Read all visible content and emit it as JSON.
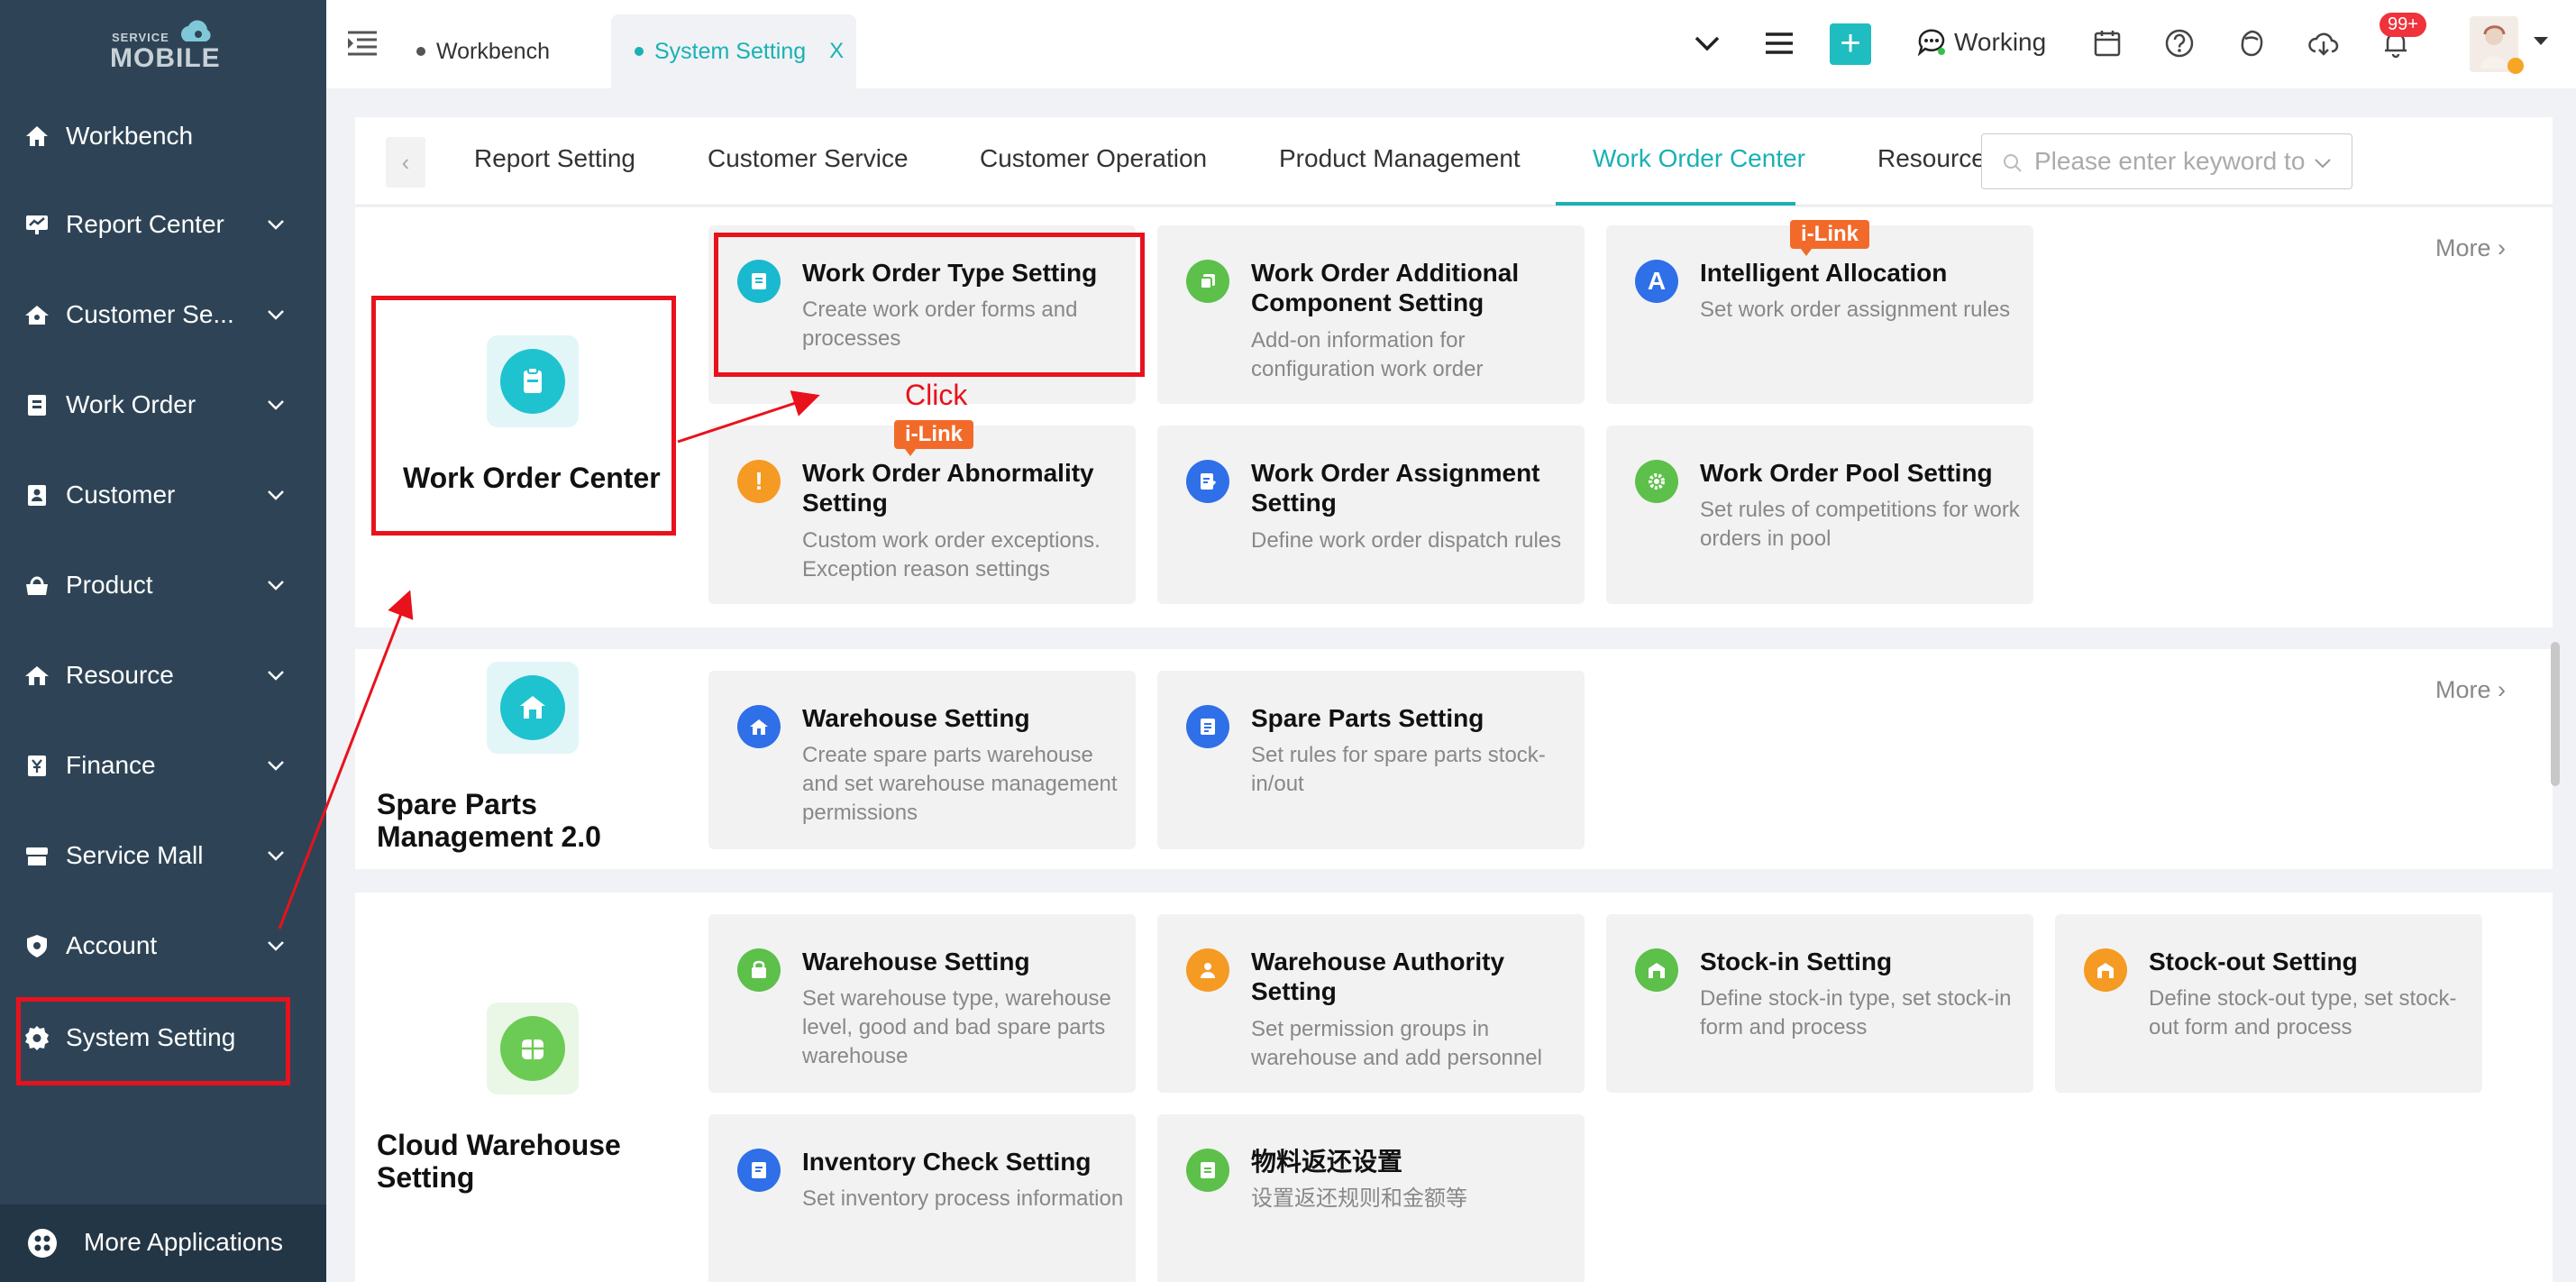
{
  "sidebar": {
    "logo_small": "SERVICE",
    "logo_big": "MOBILE",
    "items": [
      {
        "label": "Workbench",
        "icon": "home-icon",
        "has_chevron": false
      },
      {
        "label": "Report Center",
        "icon": "chart-icon",
        "has_chevron": true
      },
      {
        "label": "Customer Se...",
        "icon": "customer-service-icon",
        "has_chevron": true
      },
      {
        "label": "Work Order",
        "icon": "clipboard-icon",
        "has_chevron": true
      },
      {
        "label": "Customer",
        "icon": "person-card-icon",
        "has_chevron": true
      },
      {
        "label": "Product",
        "icon": "product-icon",
        "has_chevron": true
      },
      {
        "label": "Resource",
        "icon": "resource-icon",
        "has_chevron": true
      },
      {
        "label": "Finance",
        "icon": "finance-icon",
        "has_chevron": true
      },
      {
        "label": "Service Mall",
        "icon": "mall-icon",
        "has_chevron": true
      },
      {
        "label": "Account",
        "icon": "shield-icon",
        "has_chevron": true
      },
      {
        "label": "System Setting",
        "icon": "gear-icon",
        "has_chevron": false
      }
    ],
    "more_applications": "More Applications"
  },
  "topbar": {
    "tabs": [
      {
        "label": "Workbench",
        "active": false
      },
      {
        "label": "System Setting",
        "active": true,
        "close": "X"
      }
    ],
    "working_label": "Working",
    "notification_badge": "99+"
  },
  "category_tabs": {
    "items": [
      "Report Setting",
      "Customer Service",
      "Customer Operation",
      "Product Management",
      "Work Order Center",
      "Resource Manage"
    ],
    "active": "Work Order Center",
    "search_placeholder": "Please enter keyword to"
  },
  "sections": [
    {
      "title": "Work Order Center",
      "more": "More",
      "cards": [
        {
          "title": "Work Order Type Setting",
          "desc": "Create work order forms and processes",
          "icon_color": "#19b9d0"
        },
        {
          "title": "Work Order Additional Component Setting",
          "desc": "Add-on information for configuration work order",
          "icon_color": "#5cc04a"
        },
        {
          "title": "Intelligent Allocation",
          "desc": "Set work order assignment rules",
          "icon_color": "#2f6fe8",
          "badge": "i-Link",
          "icon_letter": "A"
        },
        {
          "title": "Work Order Abnormality Setting",
          "desc": "Custom work order exceptions. Exception reason settings",
          "icon_color": "#f59a23",
          "badge": "i-Link"
        },
        {
          "title": "Work Order Assignment Setting",
          "desc": "Define work order dispatch rules",
          "icon_color": "#2f6fe8"
        },
        {
          "title": "Work Order Pool Setting",
          "desc": "Set rules of competitions for work orders in pool",
          "icon_color": "#5cc04a"
        }
      ]
    },
    {
      "title": "Spare Parts Management 2.0",
      "more": "More",
      "cards": [
        {
          "title": "Warehouse Setting",
          "desc": "Create spare parts warehouse and set warehouse management permissions",
          "icon_color": "#2f6fe8"
        },
        {
          "title": "Spare Parts Setting",
          "desc": "Set rules for spare parts stock-in/out",
          "icon_color": "#2f6fe8"
        }
      ]
    },
    {
      "title": "Cloud Warehouse Setting",
      "cards": [
        {
          "title": "Warehouse Setting",
          "desc": "Set warehouse type, warehouse level, good and bad spare parts warehouse",
          "icon_color": "#5cc04a"
        },
        {
          "title": "Warehouse Authority Setting",
          "desc": "Set permission groups in warehouse and add personnel",
          "icon_color": "#f59a23"
        },
        {
          "title": "Stock-in Setting",
          "desc": "Define stock-in type, set stock-in form and process",
          "icon_color": "#5cc04a"
        },
        {
          "title": "Stock-out Setting",
          "desc": "Define stock-out type, set stock-out form and process",
          "icon_color": "#f59a23"
        },
        {
          "title": "Inventory Check Setting",
          "desc": "Set inventory process information",
          "icon_color": "#2f6fe8"
        },
        {
          "title": "物料返还设置",
          "desc": "设置返还规则和金额等",
          "icon_color": "#5cc04a"
        }
      ]
    }
  ],
  "annotation": {
    "click_label": "Click",
    "color": "#e8121c"
  },
  "colors": {
    "accent": "#19b1b5",
    "sidebar_bg": "#2e4456",
    "badge": "#f26a2a"
  }
}
